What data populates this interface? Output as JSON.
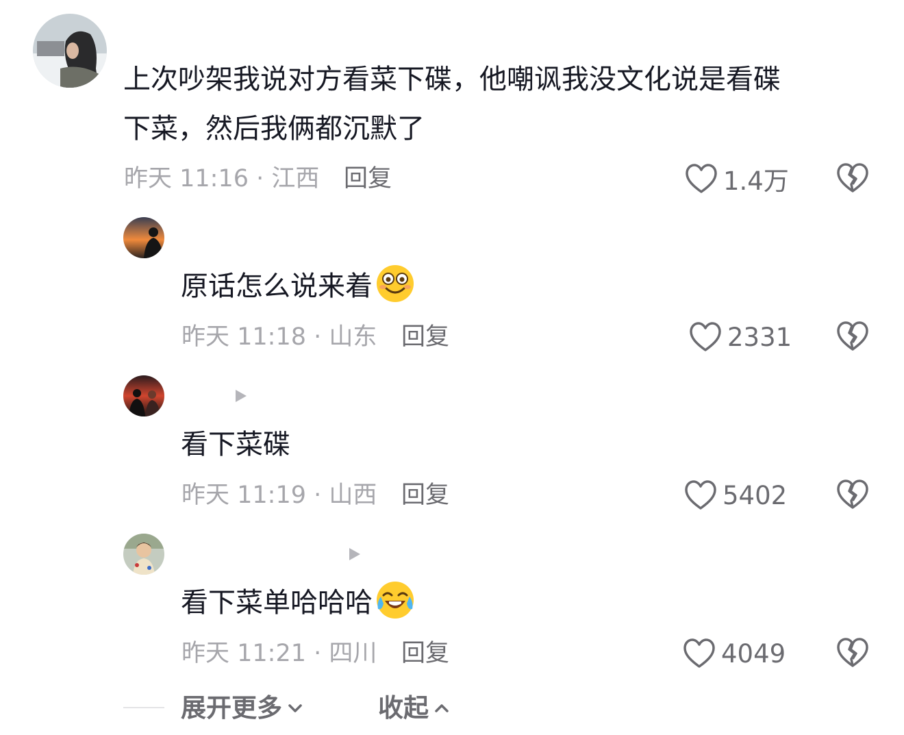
{
  "comments": [
    {
      "text_line1": "上次吵架我说对方看菜下碟，他嘲讽我没文化说是看碟",
      "text_line2": "下菜，然后我俩都沉默了",
      "meta": "昨天 11:16 · 江西",
      "reply": "回复",
      "likes": "1.4万"
    },
    {
      "text": "原话怎么说来着",
      "emoji": "smile-emoji",
      "meta": "昨天 11:18 · 山东",
      "reply": "回复",
      "likes": "2331"
    },
    {
      "text": "看下菜碟",
      "meta": "昨天 11:19 · 山西",
      "reply": "回复",
      "likes": "5402"
    },
    {
      "text": "看下菜单哈哈哈",
      "emoji": "crying-laugh-emoji",
      "meta": "昨天 11:21 · 四川",
      "reply": "回复",
      "likes": "4049"
    }
  ],
  "footer": {
    "expand_label": "展开更多",
    "collapse_label": "收起"
  },
  "colors": {
    "text": "#161823",
    "meta": "#a6a6ab",
    "action": "#6b6b70"
  }
}
